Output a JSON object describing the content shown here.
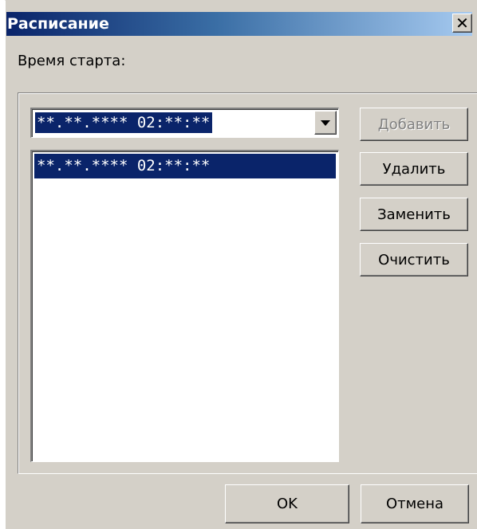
{
  "window": {
    "title": "Расписание",
    "close_symbol": "✕"
  },
  "form": {
    "start_time_label": "Время старта:",
    "combo_value": "**.**.**** 02:**:**",
    "list_items": [
      "**.**.**** 02:**:**"
    ]
  },
  "buttons": {
    "add": "Добавить",
    "delete": "Удалить",
    "replace": "Заменить",
    "clear": "Очистить",
    "ok": "OK",
    "cancel": "Отмена"
  },
  "icons": {
    "close": "close-icon",
    "dropdown": "chevron-down-icon"
  }
}
